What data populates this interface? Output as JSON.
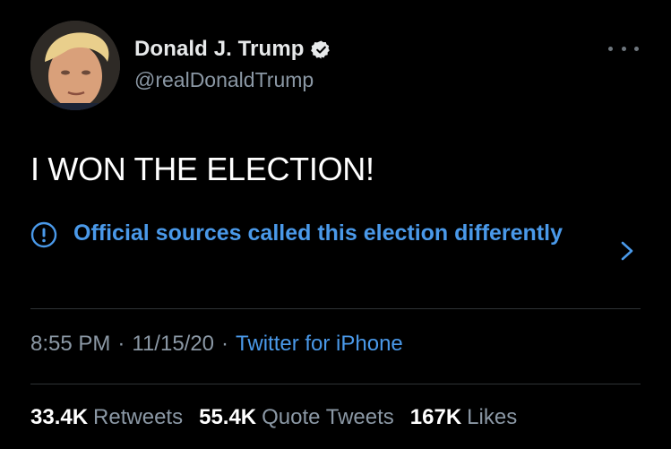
{
  "tweet": {
    "display_name": "Donald J. Trump",
    "handle": "@realDonaldTrump",
    "text": "I WON THE ELECTION!",
    "notice": "Official sources called this election differently",
    "time": "8:55 PM",
    "date": "11/15/20",
    "separator": "·",
    "source": "Twitter for iPhone",
    "stats": [
      {
        "count": "33.4K",
        "label": "Retweets"
      },
      {
        "count": "55.4K",
        "label": "Quote Tweets"
      },
      {
        "count": "167K",
        "label": "Likes"
      }
    ]
  },
  "icons": {
    "avatar": "avatar-photo",
    "verified": "verified-badge-icon",
    "more": "more-options-icon",
    "notice": "exclamation-circle-icon",
    "chevron": "chevron-right-icon"
  },
  "colors": {
    "background": "#000000",
    "text_primary": "#e7e9ea",
    "text_secondary": "#8b98a5",
    "link": "#4a99e9",
    "divider": "#2f3336"
  }
}
